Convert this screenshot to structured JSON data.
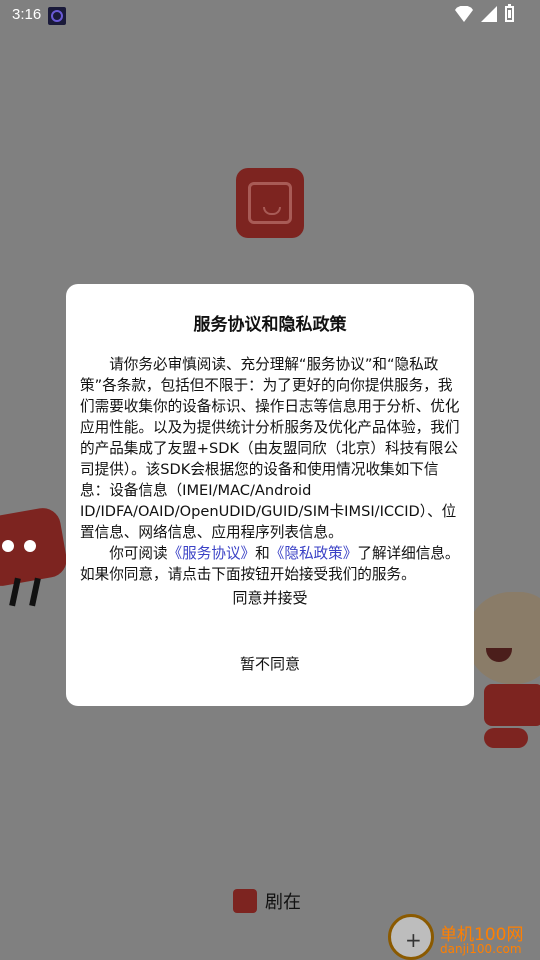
{
  "status_bar": {
    "time": "3:16"
  },
  "dialog": {
    "title": "服务协议和隐私政策",
    "paragraph1": "请你务必审慎阅读、充分理解“服务协议”和“隐私政策”各条款，包括但不限于：为了更好的向你提供服务，我们需要收集你的设备标识、操作日志等信息用于分析、优化应用性能。以及为提供统计分析服务及优化产品体验，我们的产品集成了友盟+SDK（由友盟同欣（北京）科技有限公司提供）。该SDK会根据您的设备和使用情况收集如下信息：设备信息（IMEI/MAC/Android ID/IDFA/OAID/OpenUDID/GUID/SIM卡IMSI/ICCID）、位置信息、网络信息、应用程序列表信息。",
    "paragraph2_prefix": "你可阅读",
    "link_service": "《服务协议》",
    "paragraph2_and": "和",
    "link_privacy": "《隐私政策》",
    "paragraph2_suffix": "了解详细信息。如果你同意，请点击下面按钮开始接受我们的服务。",
    "agree_button": "同意并接受",
    "decline_button": "暂不同意"
  },
  "brand": {
    "name": "剧在"
  },
  "watermark": {
    "line1": "单机100网",
    "line2": "danji100.com"
  }
}
